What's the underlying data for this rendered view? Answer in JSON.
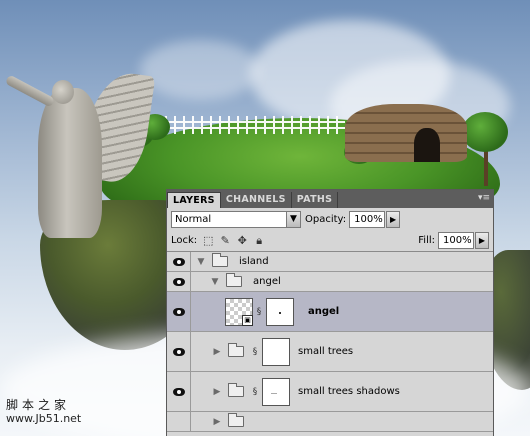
{
  "watermark": {
    "site_name": "脚本之家",
    "url": "www.Jb51.net"
  },
  "panel": {
    "tabs": [
      {
        "label": "LAYERS",
        "active": true
      },
      {
        "label": "CHANNELS",
        "active": false
      },
      {
        "label": "PATHS",
        "active": false
      }
    ],
    "menu_icon": "panel-menu-icon",
    "blend_mode": "Normal",
    "opacity_label": "Opacity:",
    "opacity_value": "100%",
    "lock_label": "Lock:",
    "fill_label": "Fill:",
    "fill_value": "100%"
  },
  "layers": [
    {
      "name": "island",
      "type": "group",
      "expanded": true,
      "indent": 0,
      "visible": true,
      "selected": false
    },
    {
      "name": "angel",
      "type": "group",
      "expanded": true,
      "indent": 1,
      "visible": true,
      "selected": false
    },
    {
      "name": "angel",
      "type": "smart-object",
      "indent": 2,
      "visible": true,
      "selected": true
    },
    {
      "name": "small trees",
      "type": "group",
      "expanded": false,
      "masked": true,
      "indent": 1,
      "visible": true,
      "selected": false
    },
    {
      "name": "small trees shadows",
      "type": "group",
      "expanded": false,
      "masked": true,
      "indent": 1,
      "visible": true,
      "selected": false
    }
  ],
  "colors": {
    "panel_bg": "#d6d6d6",
    "tabbar_bg": "#5d5d5d",
    "selected_row": "#b6b7c6"
  }
}
